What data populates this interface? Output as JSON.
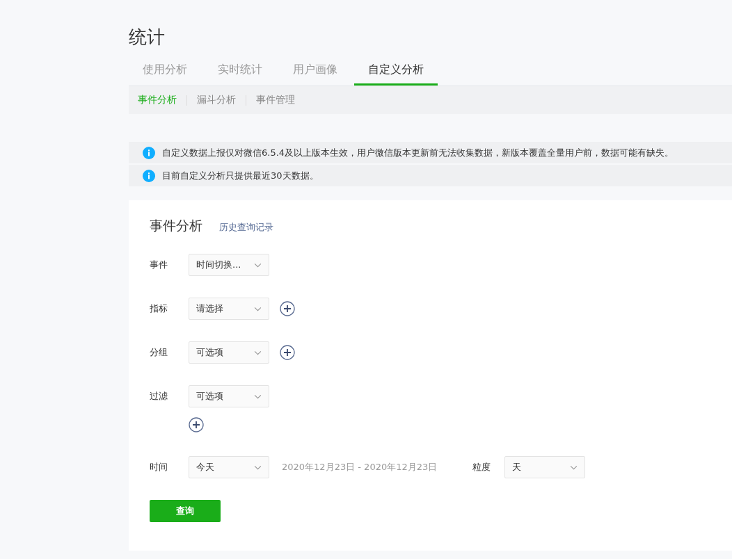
{
  "page_title": "统计",
  "tabs": [
    {
      "label": "使用分析",
      "selected": false
    },
    {
      "label": "实时统计",
      "selected": false
    },
    {
      "label": "用户画像",
      "selected": false
    },
    {
      "label": "自定义分析",
      "selected": true
    }
  ],
  "sub_tabs": [
    {
      "label": "事件分析",
      "selected": true
    },
    {
      "label": "漏斗分析",
      "selected": false
    },
    {
      "label": "事件管理",
      "selected": false
    }
  ],
  "notices": [
    "自定义数据上报仅对微信6.5.4及以上版本生效，用户微信版本更新前无法收集数据，新版本覆盖全量用户前，数据可能有缺失。",
    "目前自定义分析只提供最近30天数据。"
  ],
  "panel": {
    "title": "事件分析",
    "history_link": "历史查询记录",
    "rows": [
      {
        "kind": "select",
        "label": "事件",
        "value": "时间切换...",
        "add_inline": false,
        "add_below": false
      },
      {
        "kind": "select",
        "label": "指标",
        "value": "请选择",
        "add_inline": true,
        "add_below": false
      },
      {
        "kind": "select",
        "label": "分组",
        "value": "可选项",
        "add_inline": true,
        "add_below": false
      },
      {
        "kind": "select",
        "label": "过滤",
        "value": "可选项",
        "add_inline": false,
        "add_below": true
      },
      {
        "kind": "time",
        "label": "时间",
        "value": "今天",
        "range": "2020年12月23日 - 2020年12月23日",
        "granularity_label": "粒度",
        "granularity_value": "天"
      }
    ],
    "submit": "查询"
  }
}
